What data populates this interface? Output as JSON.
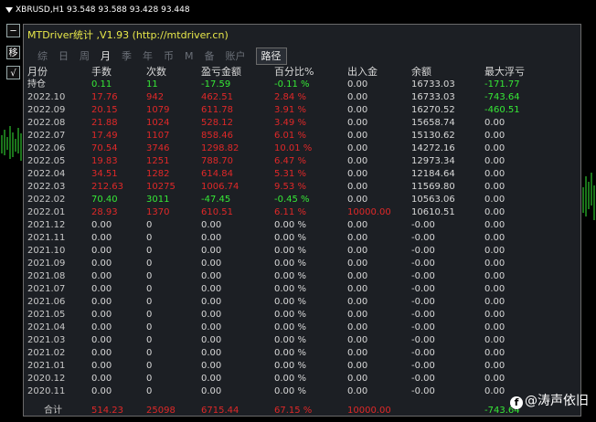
{
  "chart": {
    "header": "XBRUSD,H1  93.548 93.588 93.428 93.448"
  },
  "side_buttons": {
    "collapse": "─",
    "move": "移",
    "check": "√"
  },
  "panel": {
    "title": "MTDriver统计 ,V1.93 (http://mtdriver.cn)",
    "tabs": [
      {
        "label": "综",
        "active": false
      },
      {
        "label": "日",
        "active": false
      },
      {
        "label": "周",
        "active": false
      },
      {
        "label": "月",
        "active": true
      },
      {
        "label": "季",
        "active": false
      },
      {
        "label": "年",
        "active": false
      },
      {
        "label": "币",
        "active": false
      },
      {
        "label": "M",
        "active": false
      },
      {
        "label": "备",
        "active": false
      },
      {
        "label": "账户",
        "active": false
      },
      {
        "label": "路径",
        "active": true
      }
    ],
    "columns": [
      "月份",
      "手数",
      "次数",
      "盈亏金额",
      "百分比%",
      "出入金",
      "余额",
      "最大浮亏"
    ],
    "rows": [
      {
        "month": "持仓",
        "lots": "0.11",
        "count": "11",
        "pnl": "-17.59",
        "pct": "-0.11 %",
        "flow": "0.00",
        "balance": "16733.03",
        "dd": "-171.77",
        "color": "g"
      },
      {
        "month": "2022.10",
        "lots": "17.76",
        "count": "942",
        "pnl": "462.51",
        "pct": "2.84 %",
        "flow": "0.00",
        "balance": "16733.03",
        "dd": "-743.64",
        "color": "r"
      },
      {
        "month": "2022.09",
        "lots": "20.15",
        "count": "1079",
        "pnl": "611.78",
        "pct": "3.91 %",
        "flow": "0.00",
        "balance": "16270.52",
        "dd": "-460.51",
        "color": "r"
      },
      {
        "month": "2022.08",
        "lots": "21.88",
        "count": "1024",
        "pnl": "528.12",
        "pct": "3.49 %",
        "flow": "0.00",
        "balance": "15658.74",
        "dd": "0.00",
        "color": "r"
      },
      {
        "month": "2022.07",
        "lots": "17.49",
        "count": "1107",
        "pnl": "858.46",
        "pct": "6.01 %",
        "flow": "0.00",
        "balance": "15130.62",
        "dd": "0.00",
        "color": "r"
      },
      {
        "month": "2022.06",
        "lots": "70.54",
        "count": "3746",
        "pnl": "1298.82",
        "pct": "10.01 %",
        "flow": "0.00",
        "balance": "14272.16",
        "dd": "0.00",
        "color": "r"
      },
      {
        "month": "2022.05",
        "lots": "19.83",
        "count": "1251",
        "pnl": "788.70",
        "pct": "6.47 %",
        "flow": "0.00",
        "balance": "12973.34",
        "dd": "0.00",
        "color": "r"
      },
      {
        "month": "2022.04",
        "lots": "34.51",
        "count": "1282",
        "pnl": "614.84",
        "pct": "5.31 %",
        "flow": "0.00",
        "balance": "12184.64",
        "dd": "0.00",
        "color": "r"
      },
      {
        "month": "2022.03",
        "lots": "212.63",
        "count": "10275",
        "pnl": "1006.74",
        "pct": "9.53 %",
        "flow": "0.00",
        "balance": "11569.80",
        "dd": "0.00",
        "color": "r"
      },
      {
        "month": "2022.02",
        "lots": "70.40",
        "count": "3011",
        "pnl": "-47.45",
        "pct": "-0.45 %",
        "flow": "0.00",
        "balance": "10563.06",
        "dd": "0.00",
        "color": "g"
      },
      {
        "month": "2022.01",
        "lots": "28.93",
        "count": "1370",
        "pnl": "610.51",
        "pct": "6.11 %",
        "flow": "10000.00",
        "balance": "10610.51",
        "dd": "0.00",
        "color": "r"
      },
      {
        "month": "2021.12",
        "lots": "0.00",
        "count": "0",
        "pnl": "0.00",
        "pct": "0.00 %",
        "flow": "0.00",
        "balance": "-0.00",
        "dd": "0.00",
        "color": "w"
      },
      {
        "month": "2021.11",
        "lots": "0.00",
        "count": "0",
        "pnl": "0.00",
        "pct": "0.00 %",
        "flow": "0.00",
        "balance": "-0.00",
        "dd": "0.00",
        "color": "w"
      },
      {
        "month": "2021.10",
        "lots": "0.00",
        "count": "0",
        "pnl": "0.00",
        "pct": "0.00 %",
        "flow": "0.00",
        "balance": "-0.00",
        "dd": "0.00",
        "color": "w"
      },
      {
        "month": "2021.09",
        "lots": "0.00",
        "count": "0",
        "pnl": "0.00",
        "pct": "0.00 %",
        "flow": "0.00",
        "balance": "-0.00",
        "dd": "0.00",
        "color": "w"
      },
      {
        "month": "2021.08",
        "lots": "0.00",
        "count": "0",
        "pnl": "0.00",
        "pct": "0.00 %",
        "flow": "0.00",
        "balance": "-0.00",
        "dd": "0.00",
        "color": "w"
      },
      {
        "month": "2021.07",
        "lots": "0.00",
        "count": "0",
        "pnl": "0.00",
        "pct": "0.00 %",
        "flow": "0.00",
        "balance": "-0.00",
        "dd": "0.00",
        "color": "w"
      },
      {
        "month": "2021.06",
        "lots": "0.00",
        "count": "0",
        "pnl": "0.00",
        "pct": "0.00 %",
        "flow": "0.00",
        "balance": "-0.00",
        "dd": "0.00",
        "color": "w"
      },
      {
        "month": "2021.05",
        "lots": "0.00",
        "count": "0",
        "pnl": "0.00",
        "pct": "0.00 %",
        "flow": "0.00",
        "balance": "-0.00",
        "dd": "0.00",
        "color": "w"
      },
      {
        "month": "2021.04",
        "lots": "0.00",
        "count": "0",
        "pnl": "0.00",
        "pct": "0.00 %",
        "flow": "0.00",
        "balance": "-0.00",
        "dd": "0.00",
        "color": "w"
      },
      {
        "month": "2021.03",
        "lots": "0.00",
        "count": "0",
        "pnl": "0.00",
        "pct": "0.00 %",
        "flow": "0.00",
        "balance": "-0.00",
        "dd": "0.00",
        "color": "w"
      },
      {
        "month": "2021.02",
        "lots": "0.00",
        "count": "0",
        "pnl": "0.00",
        "pct": "0.00 %",
        "flow": "0.00",
        "balance": "-0.00",
        "dd": "0.00",
        "color": "w"
      },
      {
        "month": "2021.01",
        "lots": "0.00",
        "count": "0",
        "pnl": "0.00",
        "pct": "0.00 %",
        "flow": "0.00",
        "balance": "-0.00",
        "dd": "0.00",
        "color": "w"
      },
      {
        "month": "2020.12",
        "lots": "0.00",
        "count": "0",
        "pnl": "0.00",
        "pct": "0.00 %",
        "flow": "0.00",
        "balance": "-0.00",
        "dd": "0.00",
        "color": "w"
      },
      {
        "month": "2020.11",
        "lots": "0.00",
        "count": "0",
        "pnl": "0.00",
        "pct": "0.00 %",
        "flow": "0.00",
        "balance": "-0.00",
        "dd": "0.00",
        "color": "w"
      }
    ],
    "total": {
      "label": "合计",
      "lots": "514.23",
      "count": "25098",
      "pnl": "6715.44",
      "pct": "67.15 %",
      "flow": "10000.00",
      "balance": "",
      "dd": "-743.64"
    }
  },
  "watermark": {
    "text": "@涛声依旧",
    "icon": "f"
  },
  "colors": {
    "positive_red": "#e02828",
    "negative_green": "#36e836",
    "neutral": "#d8d8d8",
    "title_yellow": "#e8e84a"
  }
}
